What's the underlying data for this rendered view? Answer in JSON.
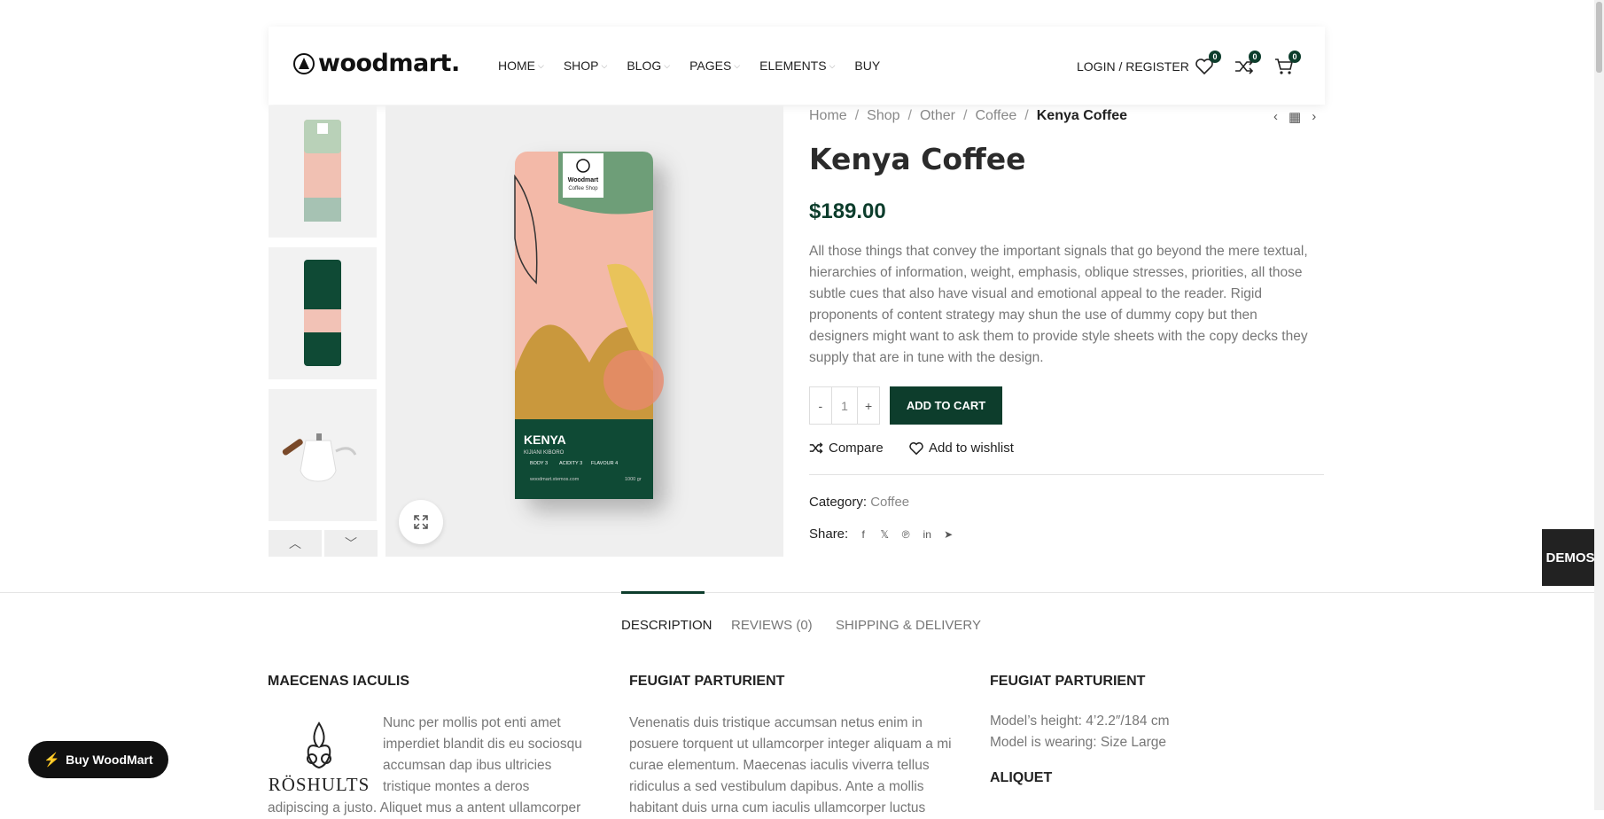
{
  "header": {
    "logo_text": "woodmart.",
    "nav": [
      {
        "label": "HOME",
        "caret": true
      },
      {
        "label": "SHOP",
        "caret": true
      },
      {
        "label": "BLOG",
        "caret": true
      },
      {
        "label": "PAGES",
        "caret": true
      },
      {
        "label": "ELEMENTS",
        "caret": true
      },
      {
        "label": "BUY",
        "caret": false
      }
    ],
    "login_label": "LOGIN / REGISTER",
    "wishlist_count": "0",
    "compare_count": "0",
    "cart_count": "0"
  },
  "breadcrumb": [
    "Home",
    "Shop",
    "Other",
    "Coffee"
  ],
  "breadcrumb_current": "Kenya Coffee",
  "product": {
    "title": "Kenya Coffee",
    "price": "$189.00",
    "description": "All those things that convey the important signals that go beyond the mere textual, hierarchies of information, weight, emphasis, oblique stresses, priorities, all those subtle cues that also have visual and emotional appeal to the reader. Rigid proponents of content strategy may shun the use of dummy copy but then designers might want to ask them to provide style sheets with the copy decks they supply that are in tune with the design.",
    "qty_minus": "-",
    "qty_value": "1",
    "qty_plus": "+",
    "add_to_cart": "ADD TO CART",
    "compare": "Compare",
    "wishlist": "Add to wishlist",
    "category_label": "Category:",
    "category_value": "Coffee",
    "share_label": "Share:",
    "pack_brand": "Woodmart",
    "pack_shop": "Coffee Shop",
    "pack_name": "KENYA",
    "pack_sub": "KIJIANI KIBORO",
    "pack_tags": [
      "BODY 3",
      "ACIDITY 3",
      "FLAVOUR 4"
    ],
    "pack_url": "woodmart.xtemos.com",
    "pack_weight": "1000 gr"
  },
  "demos_label": "DEMOS",
  "tabs": [
    {
      "label": "DESCRIPTION",
      "active": true
    },
    {
      "label": "REVIEWS (0)",
      "active": false
    },
    {
      "label": "SHIPPING & DELIVERY",
      "active": false
    }
  ],
  "columns": {
    "col1_heading": "MAECENAS IACULIS",
    "col1_logo": "RÖSHULTS",
    "col1_text": "Nunc per mollis pot enti amet imperdiet blandit dis eu sociosqu accumsan dap ibus ultricies tristique montes a deros",
    "col1_text_wrap": "adipiscing a justo. Aliquet mus a antent ullamcorper",
    "col2_heading": "FEUGIAT PARTURIENT",
    "col2_text": "Venenatis duis tristique accumsan netus enim in posuere torquent ut ullamcorper integer aliquam a mi curae elementum. Maecenas iaculis viverra tellus ridiculus a sed vestibulum dapibus. Ante a mollis habitant duis urna cum iaculis ullamcorper luctus",
    "col3_heading": "FEUGIAT PARTURIENT",
    "col3_line1": "Model’s height: 4’2.2″/184 cm",
    "col3_line2": "Model is wearing: Size Large",
    "col3_heading2": "ALIQUET"
  },
  "buy_button": "Buy WoodMart",
  "colors": {
    "accent": "#0d3d2c",
    "dark": "#111111"
  }
}
